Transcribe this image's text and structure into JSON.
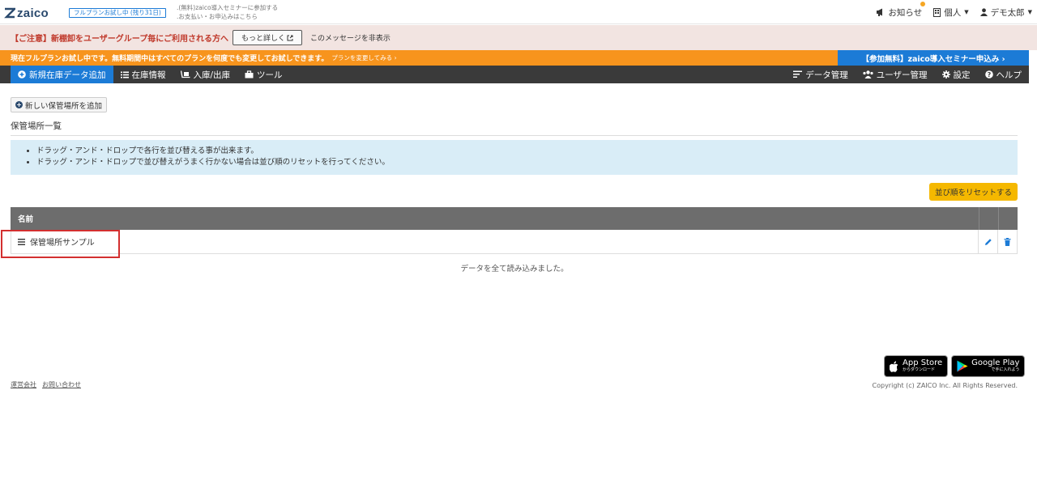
{
  "header": {
    "logo_text": "zaico",
    "trial_badge": "フルプランお試し中 (残り31日)",
    "link_1": ".(無料)zaico導入セミナーに参加する",
    "link_2": ".お支払い・お申込みはこちら",
    "notifications": "お知らせ",
    "account_type": "個人",
    "user_name": "デモ太郎"
  },
  "alert": {
    "text": "【ご注意】新棚卸をユーザーグループ毎にご利用される方へ",
    "button": "もっと詳しく",
    "hide": "このメッセージを非表示"
  },
  "trial_bar": {
    "text": "現在フルプランお試し中です。無料期間中はすべてのプランを何度でも変更してお試しできます。",
    "link": "プランを変更してみる ›",
    "seminar": "【参加無料】zaico導入セミナー申込み ›"
  },
  "nav": {
    "left": [
      "新規在庫データ追加",
      "在庫情報",
      "入庫/出庫",
      "ツール"
    ],
    "right": [
      "データ管理",
      "ユーザー管理",
      "設定",
      "ヘルプ"
    ]
  },
  "main": {
    "add_button": "新しい保管場所を追加",
    "title": "保管場所一覧",
    "info": [
      "ドラッグ・アンド・ドロップで各行を並び替える事が出来ます。",
      "ドラッグ・アンド・ドロップで並び替えがうまく行かない場合は並び順のリセットを行ってください。"
    ],
    "reset_button": "並び順をリセットする",
    "table": {
      "header_name": "名前",
      "rows": [
        {
          "name": "保管場所サンプル"
        }
      ]
    },
    "loaded": "データを全て読み込みました。"
  },
  "footer": {
    "links": [
      "運営会社",
      "お問い合わせ"
    ],
    "app_store": "App Store",
    "app_store_sub": "からダウンロード",
    "google_play": "Google Play",
    "google_play_sub": "で手に入れよう",
    "copyright": "Copyright (c) ZAICO Inc. All Rights Reserved."
  },
  "colors": {
    "primary": "#1c7bd6",
    "orange": "#f7941d",
    "yellow": "#f5b800",
    "nav": "#3a3a3a"
  }
}
